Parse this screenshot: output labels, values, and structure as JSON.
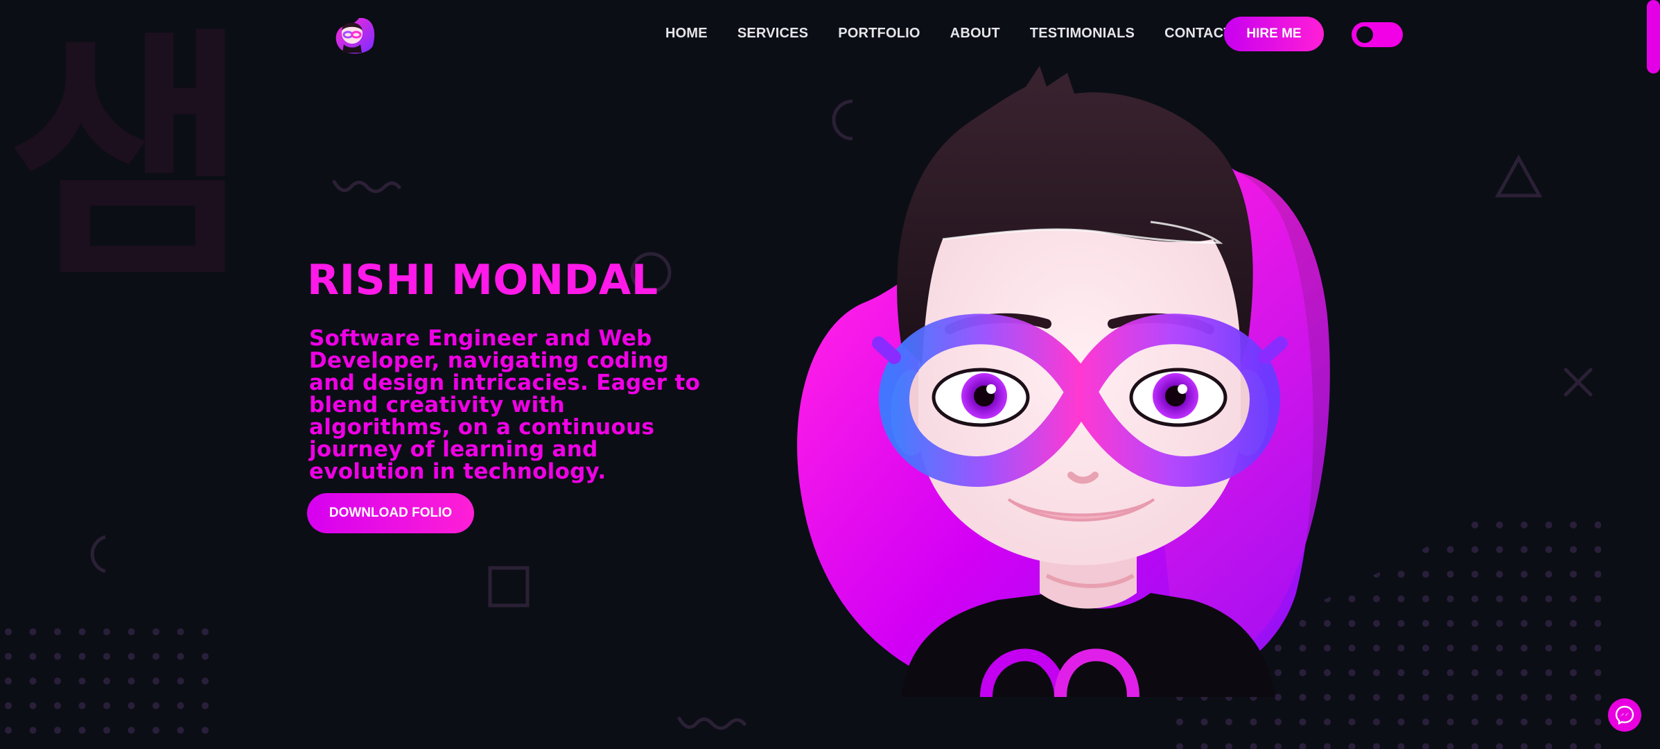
{
  "watermark": {
    "glyph": "샘"
  },
  "header": {
    "logo_icon": "avatar-logo-icon",
    "nav": [
      {
        "label": "HOME"
      },
      {
        "label": "SERVICES"
      },
      {
        "label": "PORTFOLIO"
      },
      {
        "label": "ABOUT"
      },
      {
        "label": "TESTIMONIALS"
      },
      {
        "label": "CONTACT"
      }
    ],
    "hire_label": "HIRE ME",
    "theme_toggle_icon": "theme-toggle-icon"
  },
  "hero": {
    "name": "RISHI MONDAL",
    "description": "Software Engineer and Web Developer, navigating coding and design intricacies. Eager to blend creativity with algorithms, on a continuous journey of learning and evolution in technology.",
    "cta_label": "DOWNLOAD FOLIO",
    "avatar_icon": "cartoon-avatar-illustration"
  },
  "floating": {
    "messenger_icon": "messenger-icon"
  },
  "colors": {
    "background": "#0b0e15",
    "accent": "#f000e6",
    "accent_light": "#ff1fd6",
    "violet": "#8a2cff",
    "nav_text": "#e6e6ea",
    "decor": "#2a1f3a"
  }
}
